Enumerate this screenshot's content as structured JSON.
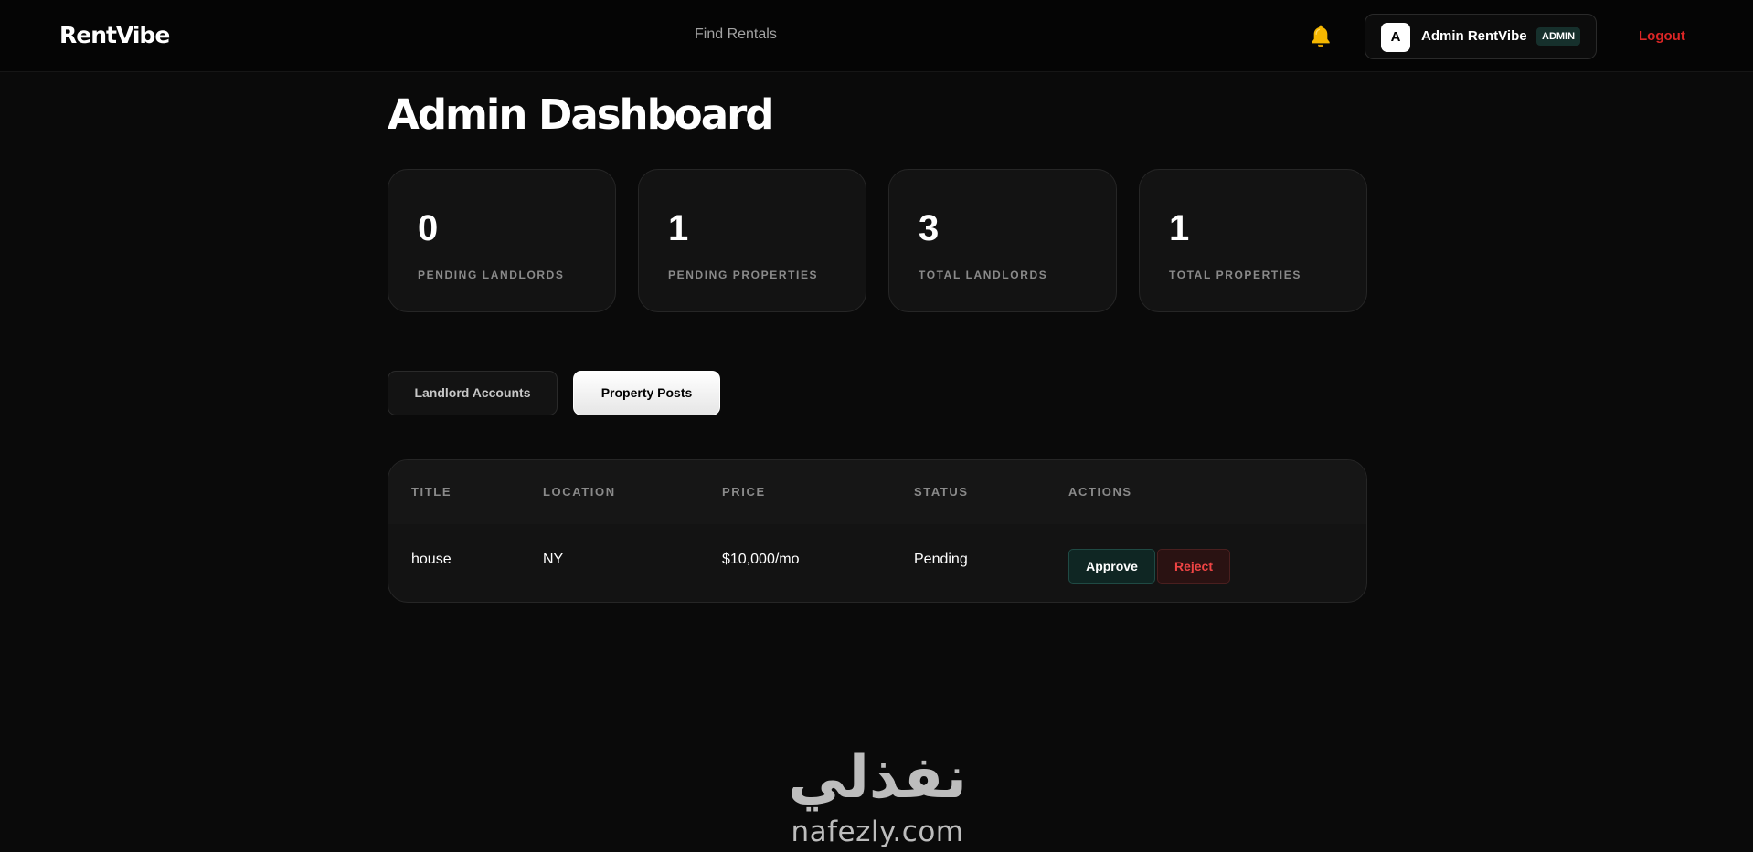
{
  "header": {
    "brand": "RentVibe",
    "nav_link": "Find Rentals",
    "notification_icon": "bell-icon",
    "user": {
      "avatar_initial": "A",
      "name": "Admin RentVibe",
      "role": "ADMIN"
    },
    "logout_label": "Logout"
  },
  "page": {
    "title": "Admin Dashboard"
  },
  "stats": [
    {
      "value": "0",
      "label": "PENDING LANDLORDS"
    },
    {
      "value": "1",
      "label": "PENDING PROPERTIES"
    },
    {
      "value": "3",
      "label": "TOTAL LANDLORDS"
    },
    {
      "value": "1",
      "label": "TOTAL PROPERTIES"
    }
  ],
  "tabs": [
    {
      "label": "Landlord Accounts",
      "active": false
    },
    {
      "label": "Property Posts",
      "active": true
    }
  ],
  "table": {
    "columns": [
      "TITLE",
      "LOCATION",
      "PRICE",
      "STATUS",
      "ACTIONS"
    ],
    "rows": [
      {
        "title": "house",
        "location": "NY",
        "price": "$10,000/mo",
        "status": "Pending",
        "approve_label": "Approve",
        "reject_label": "Reject"
      }
    ]
  },
  "watermark": {
    "arabic": "نفذلي",
    "latin": "nafezly.com"
  },
  "colors": {
    "background": "#0a0a0a",
    "accent_bell": "#f5b700",
    "logout": "#dc2626",
    "approve_bg": "#0f2623",
    "reject_text": "#ef4444"
  }
}
